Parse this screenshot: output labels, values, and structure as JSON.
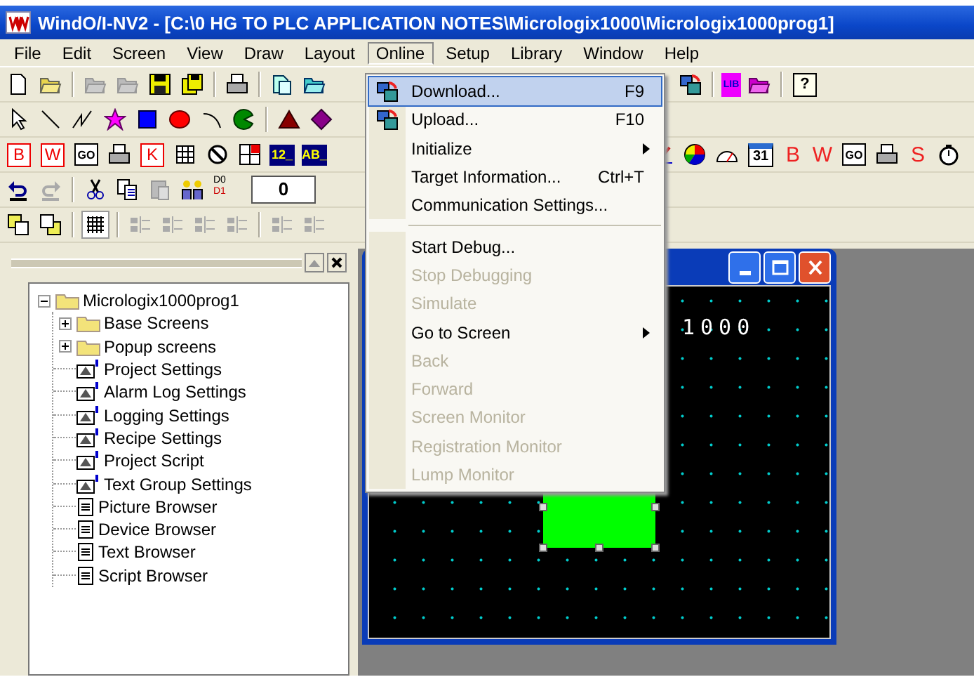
{
  "window": {
    "title": "WindO/I-NV2 - [C:\\0 HG TO PLC APPLICATION NOTES\\Micrologix1000\\Micrologix1000prog1]"
  },
  "menu_bar": [
    {
      "label": "File",
      "selected": false
    },
    {
      "label": "Edit",
      "selected": false
    },
    {
      "label": "Screen",
      "selected": false
    },
    {
      "label": "View",
      "selected": false
    },
    {
      "label": "Draw",
      "selected": false
    },
    {
      "label": "Layout",
      "selected": false
    },
    {
      "label": "Online",
      "selected": true
    },
    {
      "label": "Setup",
      "selected": false
    },
    {
      "label": "Library",
      "selected": false
    },
    {
      "label": "Window",
      "selected": false
    },
    {
      "label": "Help",
      "selected": false
    }
  ],
  "toolbar_labels": [
    "LIB",
    "?",
    "B",
    "W",
    "GO",
    "K",
    "12_",
    "AB_",
    "31",
    "B",
    "W",
    "GO",
    "S",
    "D0",
    "D1"
  ],
  "zoom_field": {
    "value": "0"
  },
  "online_menu": [
    {
      "kind": "icon-item",
      "label": "Download...",
      "shortcut": "F9",
      "selected": true,
      "disabled": false
    },
    {
      "kind": "icon-item",
      "label": "Upload...",
      "shortcut": "F10",
      "selected": false,
      "disabled": false
    },
    {
      "kind": "submenu",
      "label": "Initialize",
      "selected": false,
      "disabled": false
    },
    {
      "kind": "item",
      "label": "Target Information...",
      "shortcut": "Ctrl+T",
      "selected": false,
      "disabled": false
    },
    {
      "kind": "item",
      "label": "Communication Settings...",
      "selected": false,
      "disabled": false
    },
    {
      "kind": "separator"
    },
    {
      "kind": "item",
      "label": "Start Debug...",
      "selected": false,
      "disabled": false
    },
    {
      "kind": "item",
      "label": "Stop Debugging",
      "selected": false,
      "disabled": true
    },
    {
      "kind": "item",
      "label": "Simulate",
      "selected": false,
      "disabled": true
    },
    {
      "kind": "submenu",
      "label": "Go to Screen",
      "selected": false,
      "disabled": false
    },
    {
      "kind": "item",
      "label": "Back",
      "selected": false,
      "disabled": true
    },
    {
      "kind": "item",
      "label": "Forward",
      "selected": false,
      "disabled": true
    },
    {
      "kind": "item",
      "label": "Screen Monitor",
      "selected": false,
      "disabled": true
    },
    {
      "kind": "item",
      "label": "Registration Monitor",
      "selected": false,
      "disabled": true
    },
    {
      "kind": "item",
      "label": "Lump Monitor",
      "selected": false,
      "disabled": true
    }
  ],
  "project_tree": {
    "label": "Micrologix1000prog1",
    "kind": "folder",
    "expanded": true,
    "children": [
      {
        "label": "Base Screens",
        "kind": "folder",
        "expanded": false
      },
      {
        "label": "Popup screens",
        "kind": "folder",
        "expanded": false
      },
      {
        "label": "Project Settings",
        "kind": "settings"
      },
      {
        "label": "Alarm Log Settings",
        "kind": "settings"
      },
      {
        "label": "Logging Settings",
        "kind": "settings"
      },
      {
        "label": "Recipe Settings",
        "kind": "settings"
      },
      {
        "label": "Project Script",
        "kind": "settings"
      },
      {
        "label": "Text Group Settings",
        "kind": "settings"
      },
      {
        "label": "Picture Browser",
        "kind": "browser"
      },
      {
        "label": "Device Browser",
        "kind": "browser"
      },
      {
        "label": "Text Browser",
        "kind": "browser"
      },
      {
        "label": "Script Browser",
        "kind": "browser"
      }
    ]
  },
  "screen_editor": {
    "canvas_text": "1000"
  }
}
